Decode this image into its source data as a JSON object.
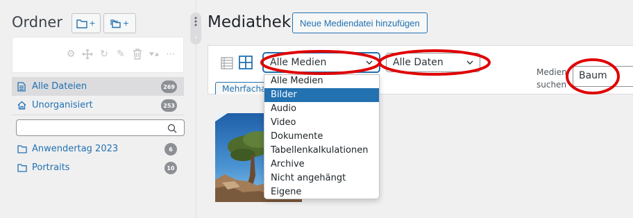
{
  "sidebar": {
    "title": "Ordner",
    "new_folder_label": "+",
    "new_category_label": "+",
    "nav": [
      {
        "label": "Alle Dateien",
        "count": "269"
      },
      {
        "label": "Unorganisiert",
        "count": "253"
      }
    ],
    "search_placeholder": "",
    "folders": [
      {
        "label": "Anwendertag 2023",
        "count": "6"
      },
      {
        "label": "Portraits",
        "count": "10"
      }
    ]
  },
  "main": {
    "title": "Mediathek",
    "add_button": "Neue Mediendatei hinzufügen",
    "media_filter": {
      "selected": "Alle Medien",
      "options": [
        "Alle Medien",
        "Bilder",
        "Audio",
        "Video",
        "Dokumente",
        "Tabellenkalkulationen",
        "Archive",
        "Nicht angehängt",
        "Eigene"
      ],
      "highlighted": "Bilder"
    },
    "date_filter": {
      "selected": "Alle Daten"
    },
    "bulk_select": "Mehrfachauswahl",
    "search_label": "Medien suchen",
    "search_value": "Baum"
  },
  "colors": {
    "accent": "#2271b1",
    "annotation": "#e00000",
    "badge": "#8c8f94"
  }
}
